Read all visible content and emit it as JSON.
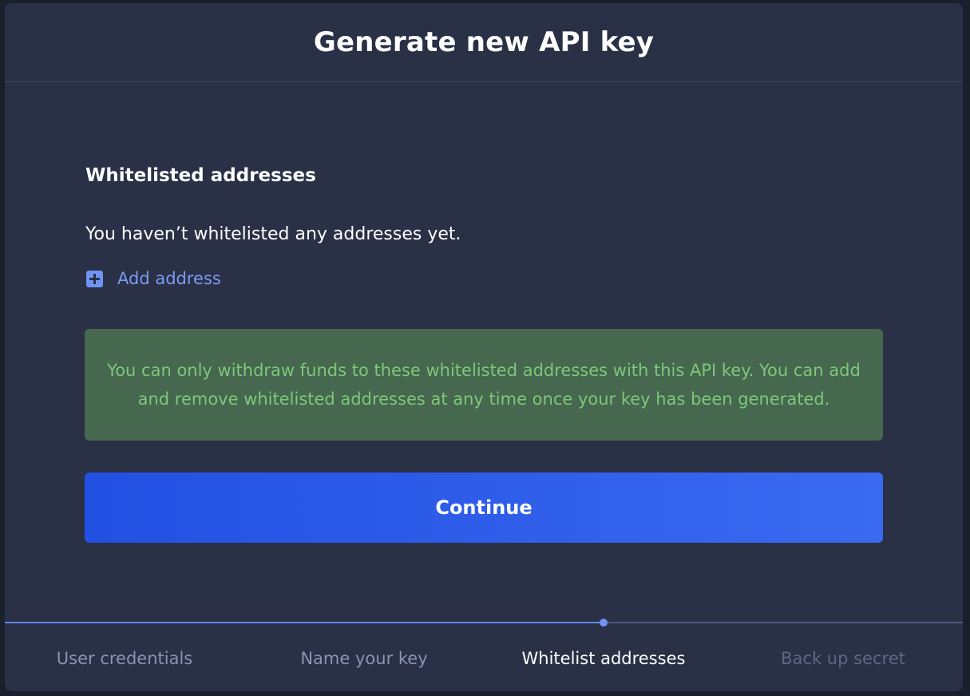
{
  "modal": {
    "title": "Generate new API key"
  },
  "whitelist": {
    "section_title": "Whitelisted addresses",
    "empty_text": "You haven’t whitelisted any addresses yet.",
    "add_label": "Add address",
    "add_icon": "plus-square-icon"
  },
  "notice": {
    "text": "You can only withdraw funds to these whitelisted addresses with this API key. You can add and remove whitelisted addresses at any time once your key has been generated.",
    "background": "#45684f",
    "text_color": "#7fc77a"
  },
  "actions": {
    "continue_label": "Continue",
    "accent": "#2f5ff0"
  },
  "stepper": {
    "steps": [
      {
        "label": "User credentials",
        "state": "done"
      },
      {
        "label": "Name your key",
        "state": "done"
      },
      {
        "label": "Whitelist addresses",
        "state": "active"
      },
      {
        "label": "Back up secret",
        "state": "pending"
      }
    ]
  }
}
